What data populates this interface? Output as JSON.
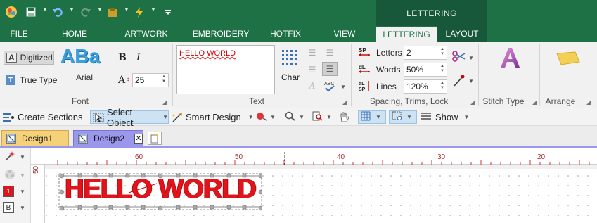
{
  "titlebar": {
    "context_header": "LETTERING",
    "qat_icons": [
      "app-logo-icon",
      "save-icon",
      "undo-icon",
      "redo-icon",
      "clipboard-icon",
      "lightning-icon",
      "customize-icon"
    ]
  },
  "tabs": {
    "file": "FILE",
    "home": "HOME",
    "artwork": "ARTWORK",
    "embroidery": "EMBROIDERY",
    "hotfix": "HOTFIX",
    "view": "VIEW",
    "lettering": "LETTERING",
    "layout": "LAYOUT"
  },
  "font_group": {
    "digitized": "Digitized",
    "true_type": "True Type",
    "font_preview": "ABa",
    "font_name": "Arial",
    "bold": "B",
    "italic": "I",
    "size_icon": "A",
    "size_value": "25",
    "label": "Font"
  },
  "text_group": {
    "text_value": "HELLO WORLD",
    "char_label": "Char",
    "label": "Text"
  },
  "spacing_group": {
    "letters_label": "Letters",
    "letters_value": "2",
    "words_label": "Words",
    "words_value": "50%",
    "lines_label": "Lines",
    "lines_value": "120%",
    "label": "Spacing, Trims, Lock Stitches"
  },
  "stitch_group": {
    "label": "Stitch Type"
  },
  "arrange_group": {
    "label": "Arrange"
  },
  "toolbar2": {
    "create_sections": "Create Sections",
    "select_object": "Select Object",
    "smart_design": "Smart Design",
    "show": "Show"
  },
  "doc_tabs": [
    "Design1",
    "Design2"
  ],
  "left_tools": {
    "color_number": "1",
    "b_label": "B"
  },
  "ruler": {
    "unit": "cm",
    "top_labels": [
      "60",
      "50",
      "40",
      "30",
      "20"
    ],
    "left_label": "50"
  },
  "design": {
    "text": "HELLO WORLD",
    "color": "#e1141b"
  },
  "colors": {
    "accent": "#1e7145",
    "accent_dark": "#17583a",
    "thread_red": "#e1141b",
    "doc_tab_active": "#9a97ec"
  }
}
